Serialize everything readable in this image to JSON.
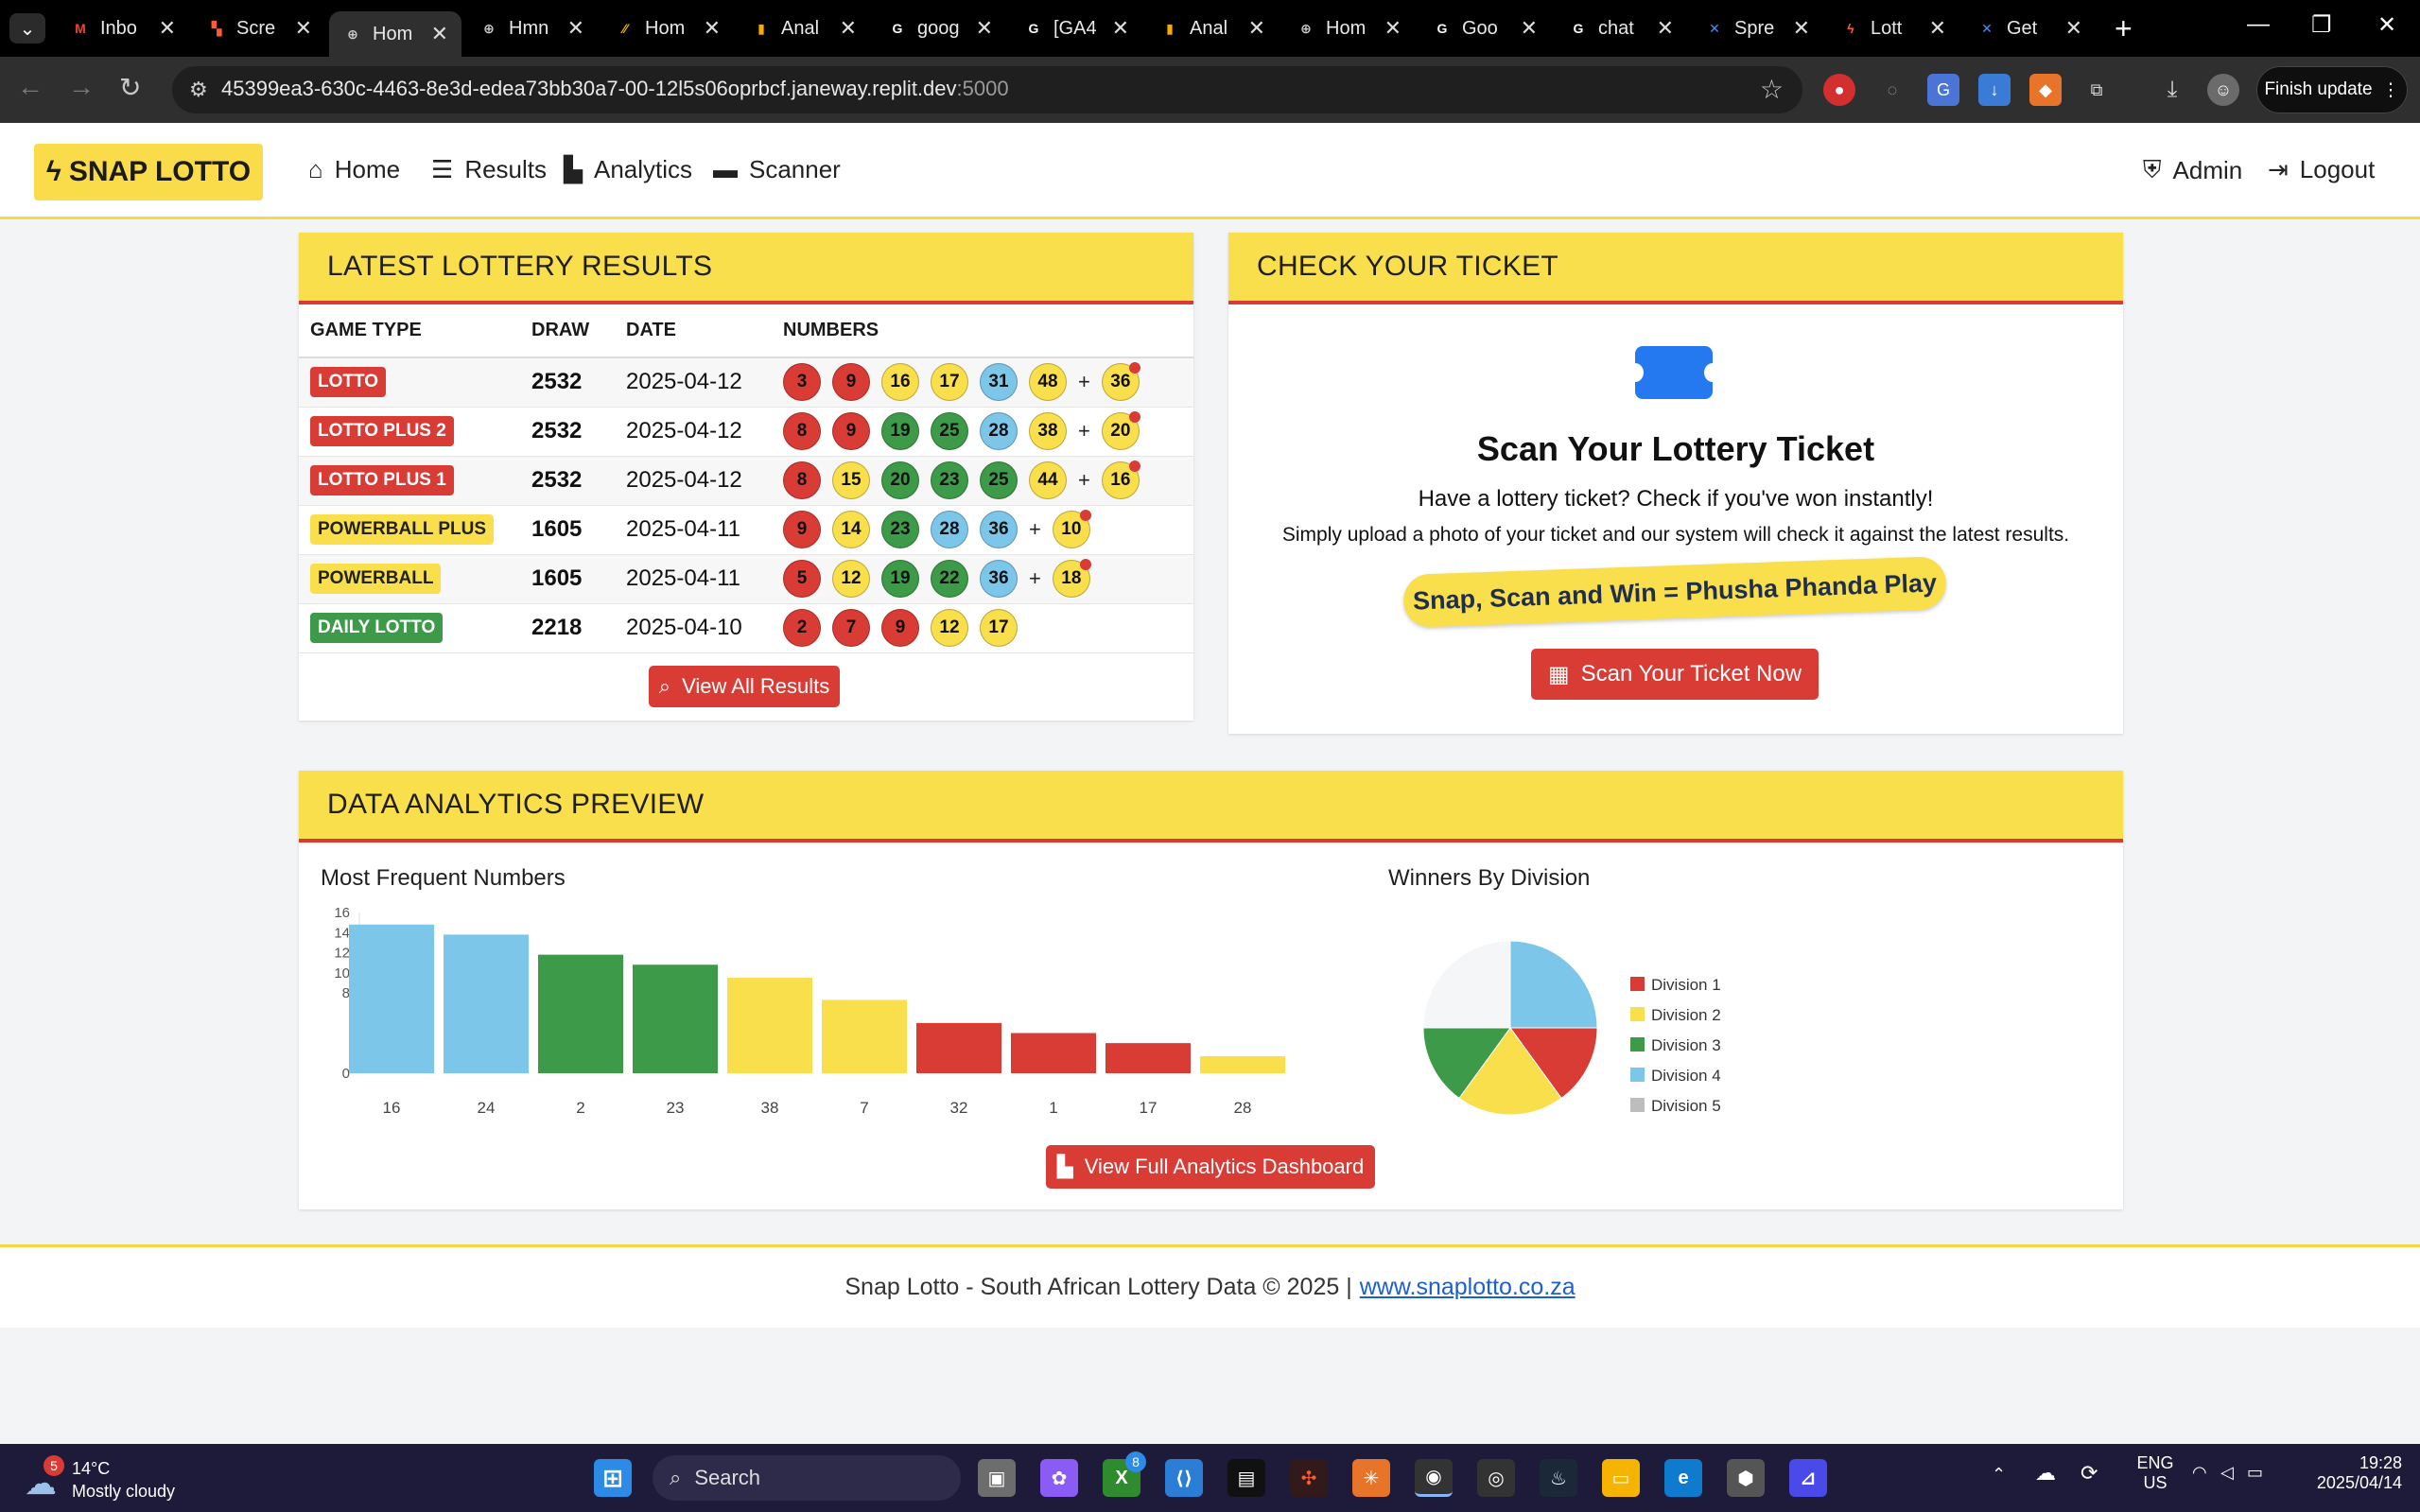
{
  "browser": {
    "tabs": [
      {
        "label": "Inbo",
        "fav": "M",
        "favcolor": "#ea4335",
        "favbg": "#000"
      },
      {
        "label": "Scre",
        "fav": "▚",
        "favcolor": "#ff5a36",
        "favbg": "#000"
      },
      {
        "label": "Hom",
        "fav": "⊕",
        "favcolor": "#cfcfcf",
        "favbg": "#2f2f2f",
        "active": true
      },
      {
        "label": "Hmn",
        "fav": "⊕",
        "favcolor": "#cfcfcf",
        "favbg": "#000"
      },
      {
        "label": "Hom",
        "fav": "⁄⁄",
        "favcolor": "#f4b400",
        "favbg": "#000"
      },
      {
        "label": "Anal",
        "fav": "▮",
        "favcolor": "#f9ab00",
        "favbg": "#000"
      },
      {
        "label": "goog",
        "fav": "G",
        "favcolor": "#fff",
        "favbg": "#000"
      },
      {
        "label": "[GA4",
        "fav": "G",
        "favcolor": "#fff",
        "favbg": "#000"
      },
      {
        "label": "Anal",
        "fav": "▮",
        "favcolor": "#f9ab00",
        "favbg": "#000"
      },
      {
        "label": "Hom",
        "fav": "⊕",
        "favcolor": "#cfcfcf",
        "favbg": "#000"
      },
      {
        "label": "Goo",
        "fav": "G",
        "favcolor": "#fff",
        "favbg": "#000"
      },
      {
        "label": "chat",
        "fav": "G",
        "favcolor": "#fff",
        "favbg": "#000"
      },
      {
        "label": "Spre",
        "fav": "✕",
        "favcolor": "#4a8cf7",
        "favbg": "#000"
      },
      {
        "label": "Lott",
        "fav": "ϟ",
        "favcolor": "#ff5a36",
        "favbg": "#000"
      },
      {
        "label": "Get",
        "fav": "✕",
        "favcolor": "#4a8cf7",
        "favbg": "#000"
      }
    ],
    "url_main": "45399ea3-630c-4463-8e3d-edea73bb30a7-00-12l5s06oprbcf.janeway.replit.dev",
    "url_port": ":5000",
    "finish_update": "Finish update"
  },
  "site": {
    "brand": "SNAP LOTTO",
    "nav": {
      "home": "Home",
      "results": "Results",
      "analytics": "Analytics",
      "scanner": "Scanner",
      "admin": "Admin",
      "logout": "Logout"
    }
  },
  "results_card": {
    "title": "LATEST LOTTERY RESULTS",
    "headers": [
      "GAME TYPE",
      "DRAW",
      "DATE",
      "NUMBERS"
    ],
    "rows": [
      {
        "game": "LOTTO",
        "badge": "red",
        "draw": "2532",
        "date": "2025-04-12",
        "numbers": [
          3,
          9,
          16,
          17,
          31,
          48
        ],
        "bonus": 36
      },
      {
        "game": "LOTTO PLUS 2",
        "badge": "red",
        "draw": "2532",
        "date": "2025-04-12",
        "numbers": [
          8,
          9,
          19,
          25,
          28,
          38
        ],
        "bonus": 20
      },
      {
        "game": "LOTTO PLUS 1",
        "badge": "red",
        "draw": "2532",
        "date": "2025-04-12",
        "numbers": [
          8,
          15,
          20,
          23,
          25,
          44
        ],
        "bonus": 16
      },
      {
        "game": "POWERBALL PLUS",
        "badge": "yellow",
        "draw": "1605",
        "date": "2025-04-11",
        "numbers": [
          9,
          14,
          23,
          28,
          36
        ],
        "bonus": 10
      },
      {
        "game": "POWERBALL",
        "badge": "yellow",
        "draw": "1605",
        "date": "2025-04-11",
        "numbers": [
          5,
          12,
          19,
          22,
          36
        ],
        "bonus": 18
      },
      {
        "game": "DAILY LOTTO",
        "badge": "green",
        "draw": "2218",
        "date": "2025-04-10",
        "numbers": [
          2,
          7,
          9,
          12,
          17
        ],
        "bonus": null
      }
    ],
    "view_all": "View All Results"
  },
  "ticket_card": {
    "title": "CHECK YOUR TICKET",
    "heading": "Scan Your Lottery Ticket",
    "line1": "Have a lottery ticket? Check if you've won instantly!",
    "line2": "Simply upload a photo of your ticket and our system will check it against the latest results.",
    "slogan": "Snap, Scan and Win = Phusha Phanda Play",
    "scan_button": "Scan Your Ticket Now"
  },
  "analytics_card": {
    "title": "DATA ANALYTICS PREVIEW",
    "bar_title": "Most Frequent Numbers",
    "pie_title": "Winners By Division",
    "button": "View Full Analytics Dashboard"
  },
  "chart_data": [
    {
      "type": "bar",
      "title": "Most Frequent Numbers",
      "categories": [
        "16",
        "24",
        "2",
        "23",
        "38",
        "7",
        "32",
        "1",
        "17",
        "28"
      ],
      "values": [
        14.8,
        13.8,
        11.8,
        10.8,
        9.5,
        7.3,
        5.0,
        4.0,
        3.0,
        1.7
      ],
      "colors": [
        "#7cc6ea",
        "#7cc6ea",
        "#3d9a48",
        "#3d9a48",
        "#fadf4d",
        "#fadf4d",
        "#d93b35",
        "#d93b35",
        "#d93b35",
        "#fadf4d"
      ],
      "ytick_labels": [
        "16",
        "14",
        "12",
        "10",
        "8",
        "0"
      ],
      "ylim": [
        0,
        16
      ]
    },
    {
      "type": "pie",
      "title": "Winners By Division",
      "labels": [
        "Division 1",
        "Division 2",
        "Division 3",
        "Division 4",
        "Division 5"
      ],
      "values": [
        15,
        20,
        15,
        25,
        25
      ],
      "colors": [
        "#d93b35",
        "#fadf4d",
        "#3d9a48",
        "#7cc6ea",
        "#f5f6f8"
      ],
      "legend_colors": [
        "#d93b35",
        "#fadf4d",
        "#3d9a48",
        "#7cc6ea",
        "#bdbdbd"
      ]
    }
  ],
  "footer": {
    "text": "Snap Lotto - South African Lottery Data © 2025 |",
    "link": "www.snaplotto.co.za"
  },
  "taskbar": {
    "weather_temp": "14°C",
    "weather_desc": "Mostly cloudy",
    "weather_badge": "5",
    "search": "Search",
    "lang1": "ENG",
    "lang2": "US",
    "time": "19:28",
    "date": "2025/04/14",
    "xbox_badge": "8"
  }
}
